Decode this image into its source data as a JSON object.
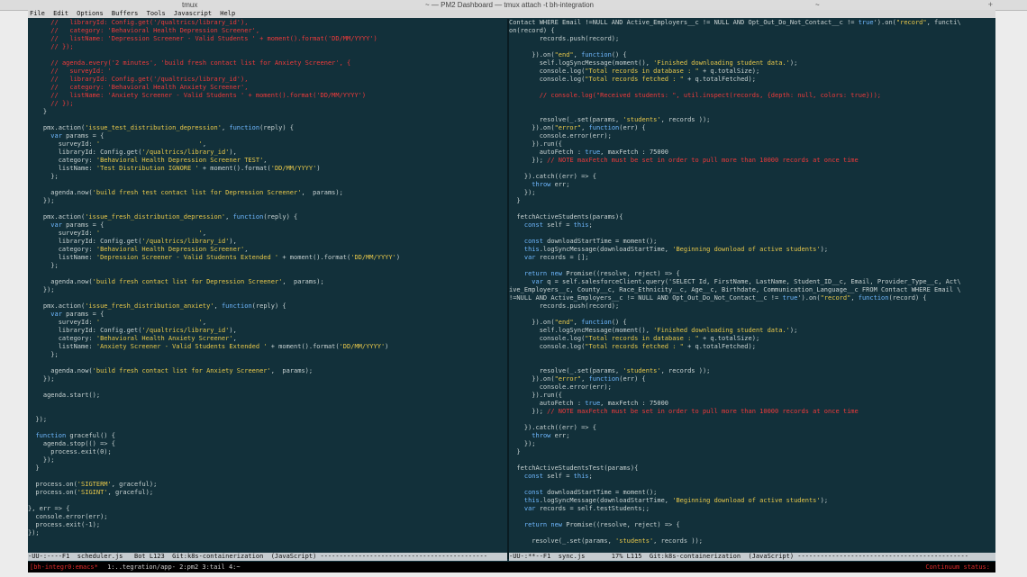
{
  "mac": {
    "tab1": "tmux",
    "tab2": "~ — PM2 Dashboard — tmux attach -t bh-integration",
    "tab3": "~",
    "plus": "+"
  },
  "menu": [
    "File",
    "Edit",
    "Options",
    "Buffers",
    "Tools",
    "Javascript",
    "Help"
  ],
  "left_code": "      //   libraryId: Config.get('/qualtrics/library_id'),\n      //   category: 'Behavioral Health Depression Screener',\n      //   listName: 'Depression Screener - Valid Students ' + moment().format('DD/MM/YYYY')\n      // });\n\n      // agenda.every('2 minutes', 'build fresh contact list for Anxiety Screener', {\n      //   surveyId: '\n      //   libraryId: Config.get('/qualtrics/library_id'),\n      //   category: 'Behavioral Health Anxiety Screener',\n      //   listName: 'Anxiety Screener - Valid Students ' + moment().format('DD/MM/YYYY')\n      // });\n    }\n\n    pmx.action('issue_test_distribution_depression', function(reply) {\n      var params = {\n        surveyId: '                          ',\n        libraryId: Config.get('/qualtrics/library_id'),\n        category: 'Behavioral Health Depression Screener TEST',\n        listName: 'Test Distribution IGNORE ' + moment().format('DD/MM/YYYY')\n      };\n\n      agenda.now('build fresh test contact list for Depression Screener',  params);\n    });\n\n    pmx.action('issue_fresh_distribution_depression', function(reply) {\n      var params = {\n        surveyId: '                          ',\n        libraryId: Config.get('/qualtrics/library_id'),\n        category: 'Behavioral Health Depression Screener',\n        listName: 'Depression Screener - Valid Students Extended ' + moment().format('DD/MM/YYYY')\n      };\n\n      agenda.now('build fresh contact list for Depression Screener',  params);\n    });\n\n    pmx.action('issue_fresh_distribution_anxiety', function(reply) {\n      var params = {\n        surveyId: '                          ',\n        libraryId: Config.get('/qualtrics/library_id'),\n        category: 'Behavioral Health Anxiety Screener',\n        listName: 'Anxiety Screener - Valid Students Extended ' + moment().format('DD/MM/YYYY')\n      };\n\n      agenda.now('build fresh contact list for Anxiety Screener',  params);\n    });\n\n    agenda.start();\n\n\n  });\n\n  function graceful() {\n    agenda.stop(() => {\n      process.exit(0);\n    });\n  }\n\n  process.on('SIGTERM', graceful);\n  process.on('SIGINT', graceful);\n\n}, err => {\n  console.error(err);\n  process.exit(-1);\n});",
  "right_code": "Contact WHERE Email !=NULL AND Active_Employers__c != NULL AND Opt_Out_Do_Not_Contact__c != true').on(\"record\", functi\\\non(record) {\n        records.push(record);\n\n      }).on(\"end\", function() {\n        self.logSyncMessage(moment(), 'Finished downloading student data.');\n        console.log(\"Total records in database : \" + q.totalSize);\n        console.log(\"Total records fetched : \" + q.totalFetched);\n\n        // console.log(\"Received students: \", util.inspect(records, {depth: null, colors: true}));\n\n\n        resolve(_.set(params, 'students', records ));\n      }).on(\"error\", function(err) {\n        console.error(err);\n      }).run({\n        autoFetch : true, maxFetch : 75000\n      }); // NOTE maxFetch must be set in order to pull more than 10000 records at once time\n\n    }).catch((err) => {\n      throw err;\n    });\n  }\n\n  fetchActiveStudents(params){\n    const self = this;\n\n    const downloadStartTime = moment();\n    this.logSyncMessage(downloadStartTime, 'Beginning download of active students');\n    var records = [];\n\n    return new Promise((resolve, reject) => {\n      var q = self.salesforceClient.query('SELECT Id, FirstName, LastName, Student_ID__c, Email, Provider_Type__c, Act\\\nive_Employers__c, County__c, Race_Ethnicity__c, Age__c, Birthdate, Communication_Language__c FROM Contact WHERE Email \\\n!=NULL AND Active_Employers__c != NULL AND Opt_Out_Do_Not_Contact__c != true').on(\"record\", function(record) {\n        records.push(record);\n\n      }).on(\"end\", function() {\n        self.logSyncMessage(moment(), 'Finished downloading student data.');\n        console.log(\"Total records in database : \" + q.totalSize);\n        console.log(\"Total records fetched : \" + q.totalFetched);\n\n\n        resolve(_.set(params, 'students', records ));\n      }).on(\"error\", function(err) {\n        console.error(err);\n      }).run({\n        autoFetch : true, maxFetch : 75000\n      }); // NOTE maxFetch must be set in order to pull more than 10000 records at once time\n\n    }).catch((err) => {\n      throw err;\n    });\n  }\n\n  fetchActiveStudentsTest(params){\n    const self = this;\n\n    const downloadStartTime = moment();\n    this.logSyncMessage(downloadStartTime, 'Beginning download of active students');\n    var records = self.testStudents;;\n\n    return new Promise((resolve, reject) => {\n\n      resolve(_.set(params, 'students', records ));",
  "modeline_left": "-UU-:----F1  scheduler.js   Bot L123  Git:k8s-containerization  (JavaScript) --------------------------------------------",
  "modeline_right": "-UU-:**--F1  sync.js       17% L115  Git:k8s-containerization  (JavaScript) ---------------------------------------------",
  "tmux": {
    "session": "[bh-integr0:emacs*",
    "windows": "1:..tegration/app- 2:pm2  3:tail  4:~",
    "status": "Continuum status:"
  },
  "colors": {
    "background": "#12303a",
    "text": "#c8d2d2",
    "keyword": "#6fb8ff",
    "string": "#e8c84a",
    "comment": "#ef3a3a",
    "tmux_accent": "#e02b2b"
  }
}
